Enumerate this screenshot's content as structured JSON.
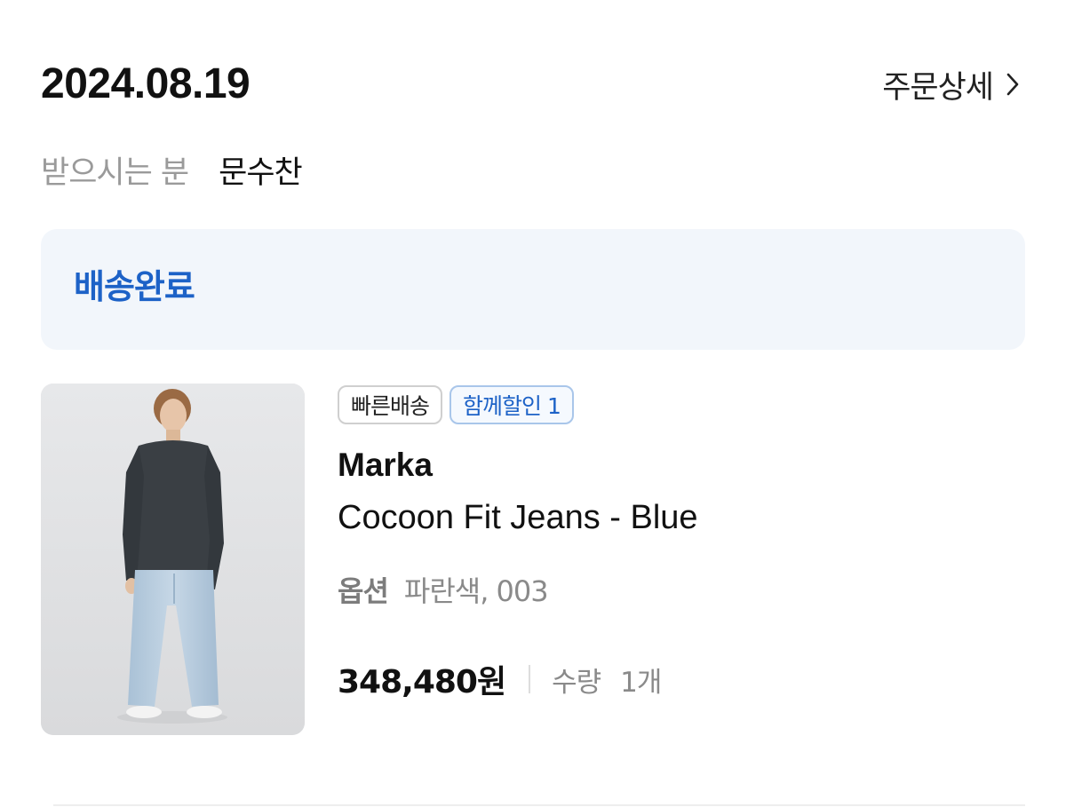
{
  "order": {
    "date": "2024.08.19",
    "detail_link_label": "주문상세",
    "detail_link_icon": "chevron-right-icon"
  },
  "recipient": {
    "label": "받으시는 분",
    "name": "문수찬"
  },
  "status": {
    "label": "배송완료",
    "color": "#1d62c7",
    "background": "#f2f6fb"
  },
  "product": {
    "image_icon": "product-photo",
    "badges": [
      {
        "label": "빠른배송"
      },
      {
        "label": "함께할인 1"
      }
    ],
    "brand": "Marka",
    "name": "Cocoon Fit Jeans - Blue",
    "option_label": "옵션",
    "option_value": "파란색, 003",
    "price": "348,480원",
    "quantity_label": "수량",
    "quantity_value": "1개"
  }
}
